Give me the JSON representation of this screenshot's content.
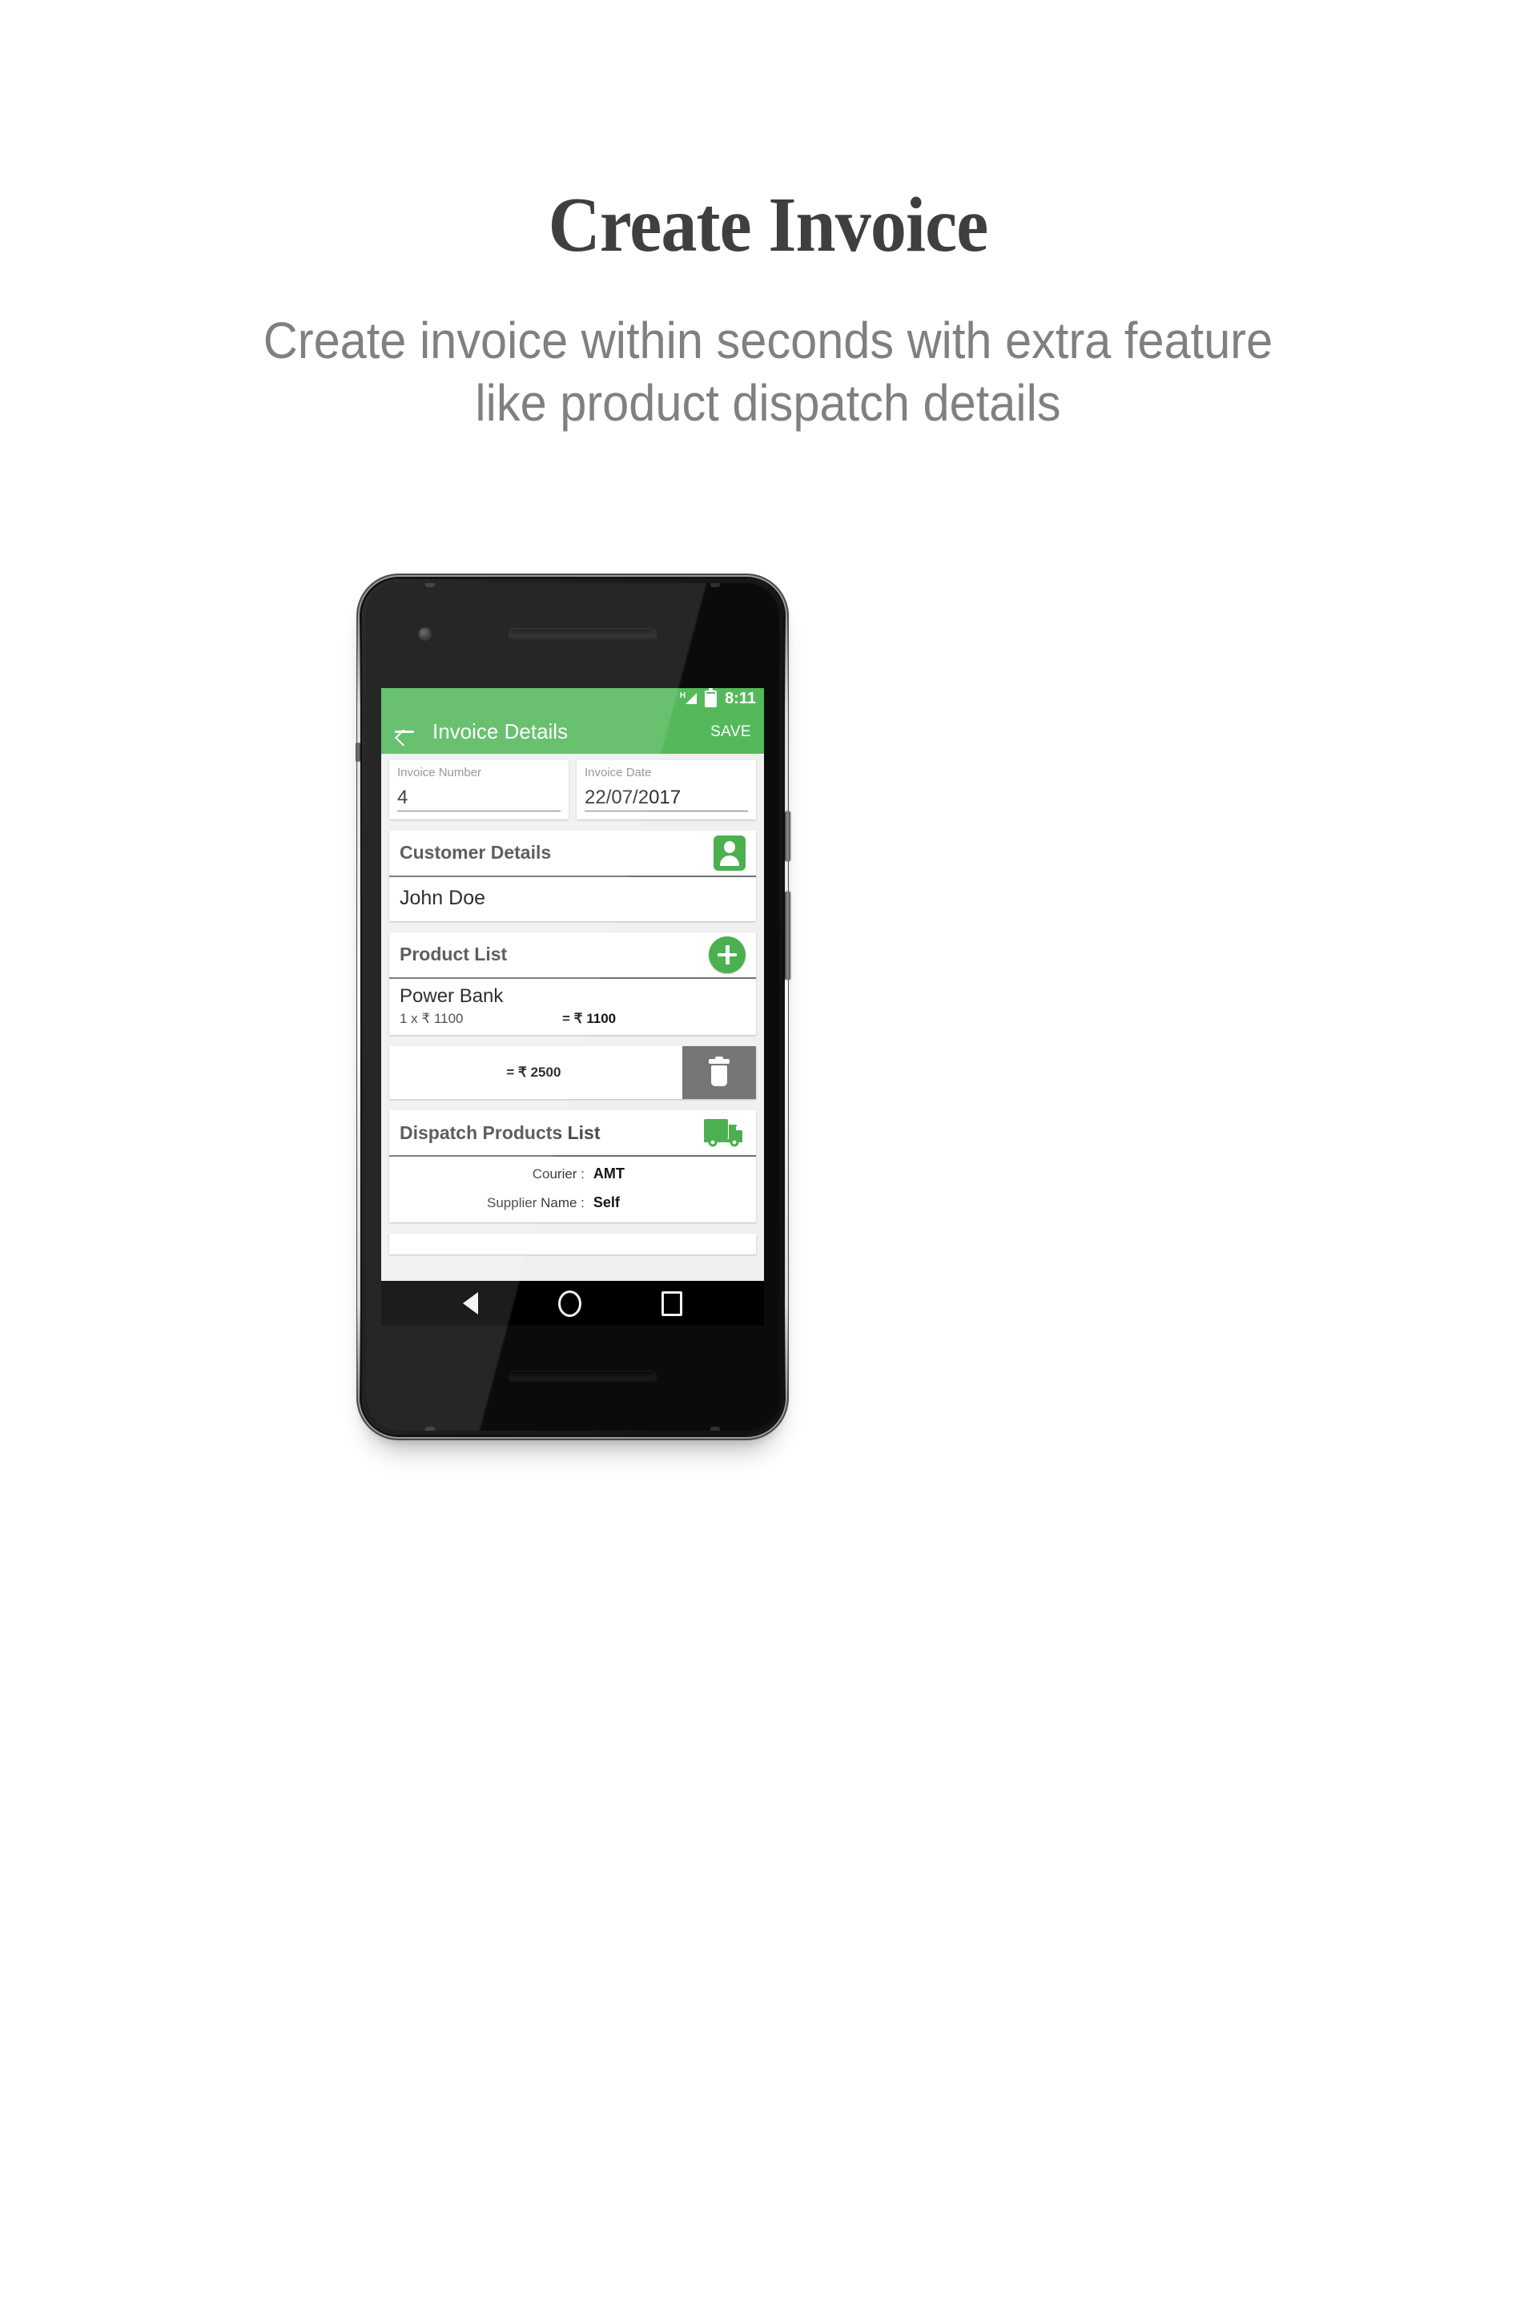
{
  "hero": {
    "title": "Create Invoice",
    "subtitle_line1": "Create invoice within seconds with extra feature",
    "subtitle_line2": "like product dispatch details"
  },
  "colors": {
    "brand_green": "#55b95c",
    "accent_green": "#4caf50",
    "delete_gray": "#767676",
    "screen_bg": "#f0f0f0"
  },
  "status_bar": {
    "network_type": "H",
    "signal_icon": "signal-triangle-icon",
    "battery_icon": "battery-icon",
    "time": "8:11"
  },
  "app_bar": {
    "back_icon": "arrow-left-icon",
    "title": "Invoice Details",
    "save_label": "SAVE"
  },
  "fields": [
    {
      "label": "Invoice Number",
      "value": "4"
    },
    {
      "label": "Invoice Date",
      "value": "22/07/2017"
    }
  ],
  "customer_section": {
    "title": "Customer Details",
    "action_icon": "contact-person-icon",
    "name": "John Doe"
  },
  "product_section": {
    "title": "Product List",
    "action_icon": "add-plus-icon",
    "items": [
      {
        "name": "Power Bank",
        "qty_price": "1 x ₹ 1100",
        "line_total": "= ₹ 1100"
      }
    ],
    "grand_total": "= ₹ 2500",
    "delete_icon": "trash-icon"
  },
  "dispatch_section": {
    "title": "Dispatch Products List",
    "action_icon": "delivery-truck-icon",
    "rows": [
      {
        "label": "Courier :",
        "value": "AMT"
      },
      {
        "label": "Supplier Name :",
        "value": "Self"
      }
    ]
  },
  "nav_bar": {
    "back_icon": "nav-back-triangle-icon",
    "home_icon": "nav-home-circle-icon",
    "recents_icon": "nav-recents-square-icon"
  }
}
